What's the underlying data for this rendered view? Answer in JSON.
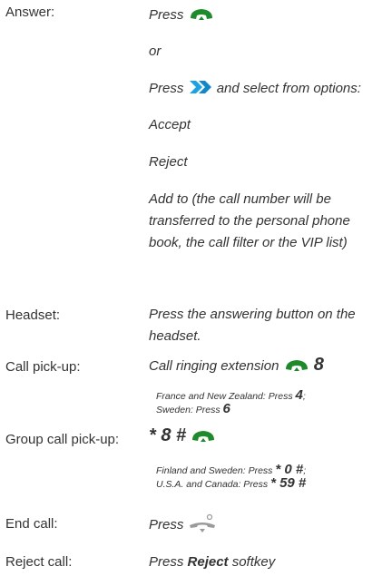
{
  "answer": {
    "label": "Answer:",
    "press": "Press",
    "or": "or",
    "press2": "Press",
    "select_from": "and select from options:",
    "options": [
      "Accept",
      "Reject",
      "Add to (the call number will be transferred to the personal phone book, the call filter or the VIP list)"
    ]
  },
  "headset": {
    "label": "Headset:",
    "text": "Press the answering button on the headset."
  },
  "pickup": {
    "label": "Call pick-up:",
    "text": "Call ringing extension",
    "code": "8",
    "note1": "France and New Zealand: Press",
    "note1_code": "4",
    "note1_end": ";",
    "note2": "Sweden: Press",
    "note2_code": "6"
  },
  "group": {
    "label": "Group call pick-up:",
    "code": "* 8 #",
    "note1": "Finland and Sweden: Press",
    "note1_code": "* 0 #",
    "note1_end": ";",
    "note2": "U.S.A. and Canada: Press",
    "note2_code": "* 59 #"
  },
  "end": {
    "label": "End call:",
    "press": "Press"
  },
  "reject": {
    "label": "Reject call:",
    "press": "Press",
    "key": "Reject",
    "softkey": "softkey"
  },
  "icons": [
    "green-handset-icon",
    "double-chevron-right-icon",
    "hang-up-handset-icon"
  ],
  "colors": {
    "text": "#333333",
    "handset": "#1f8a2b",
    "chevron": "#1aa3e0"
  }
}
